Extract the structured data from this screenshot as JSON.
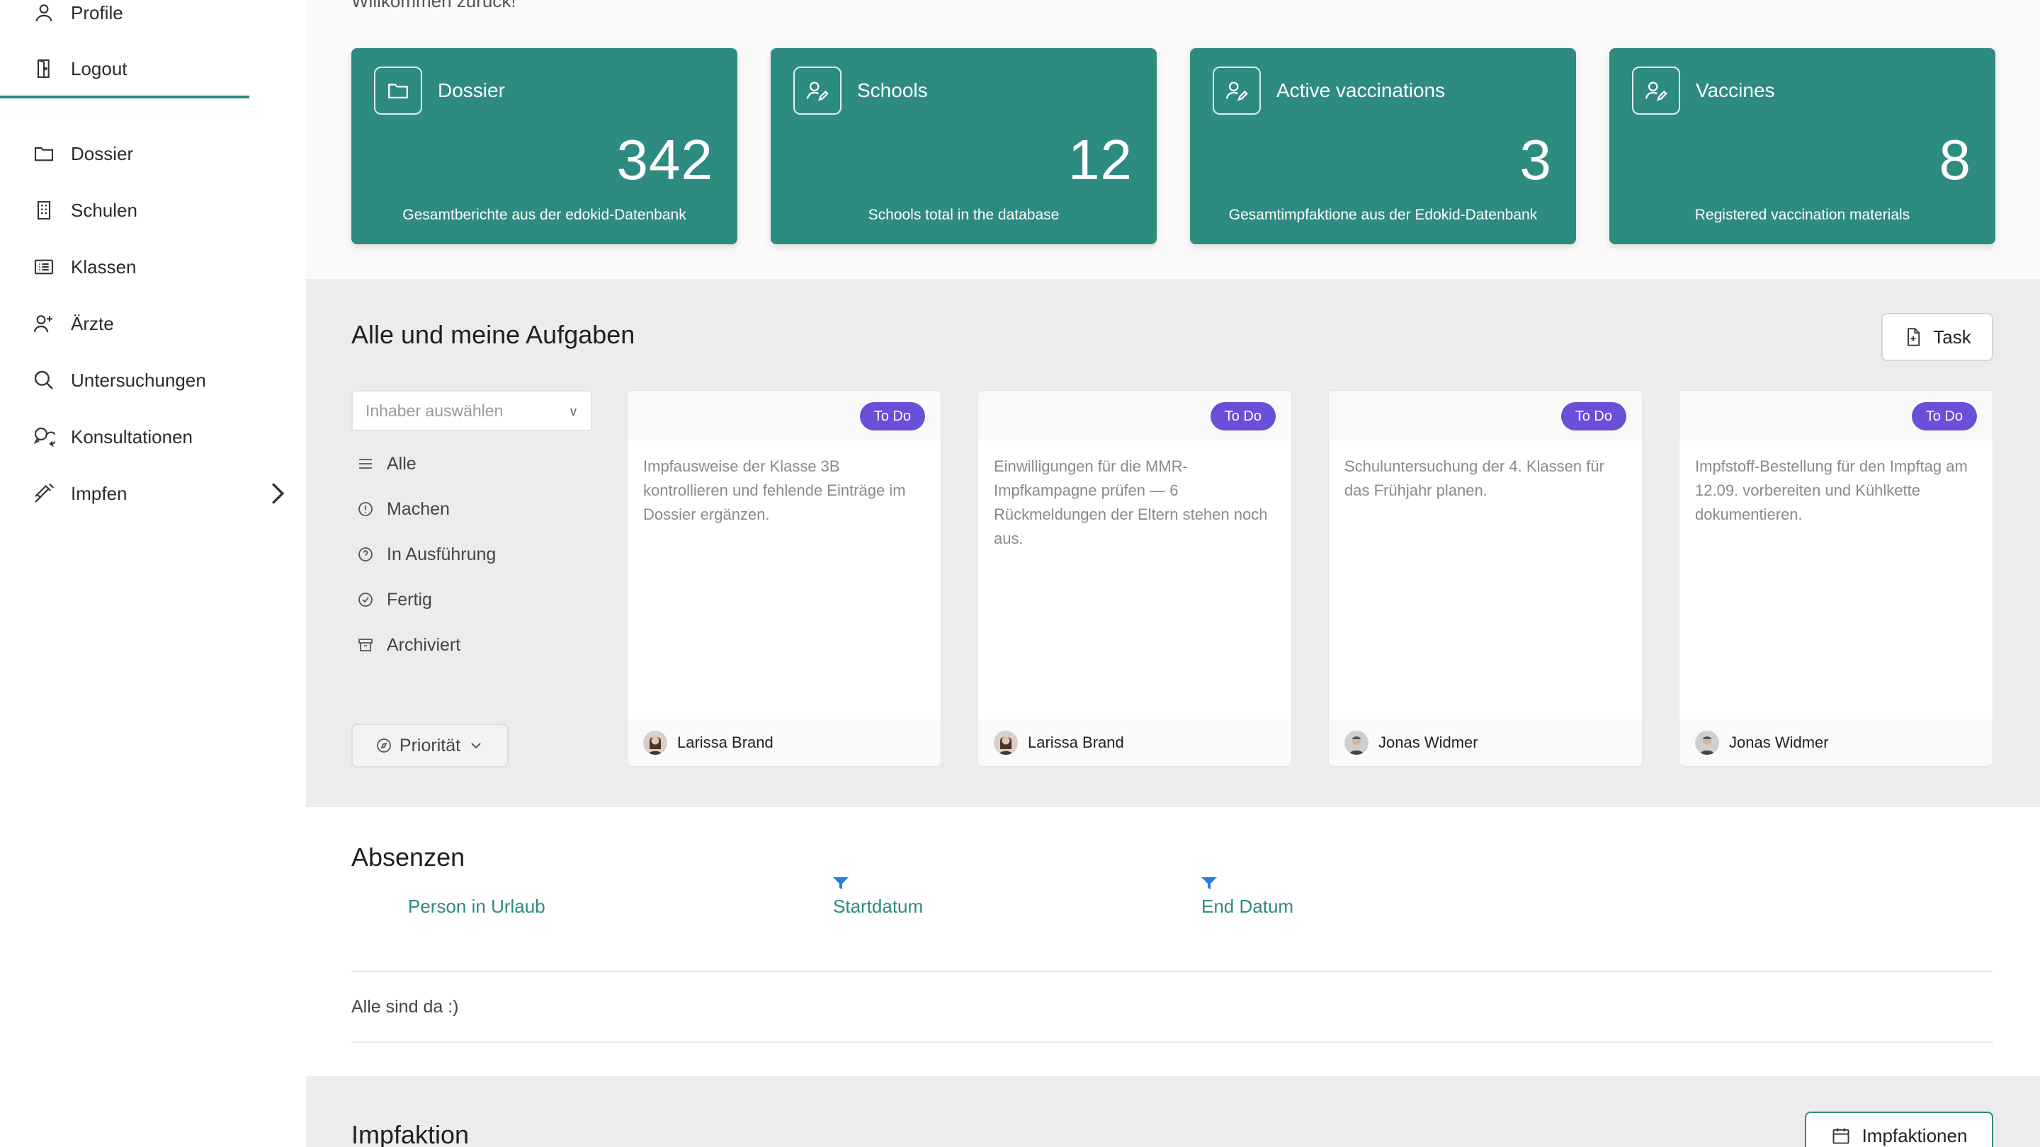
{
  "sidebar": {
    "items": [
      {
        "label": "Profile",
        "icon": "user-icon"
      },
      {
        "label": "Logout",
        "icon": "door-icon"
      },
      {
        "label": "Dossier",
        "icon": "folder-icon"
      },
      {
        "label": "Schulen",
        "icon": "building-icon"
      },
      {
        "label": "Klassen",
        "icon": "list-icon"
      },
      {
        "label": "Ärzte",
        "icon": "user-plus-icon"
      },
      {
        "label": "Untersuchungen",
        "icon": "search-icon"
      },
      {
        "label": "Konsultationen",
        "icon": "chat-icon"
      },
      {
        "label": "Impfen",
        "icon": "syringe-icon"
      }
    ]
  },
  "welcome": "Willkommen zurück!",
  "stats": [
    {
      "title": "Dossier",
      "value": "342",
      "subtitle": "Gesamtberichte aus der edokid-Datenbank",
      "icon": "folder-icon"
    },
    {
      "title": "Schools",
      "value": "12",
      "subtitle": "Schools total in the database",
      "icon": "user-edit-icon"
    },
    {
      "title": "Active vaccinations",
      "value": "3",
      "subtitle": "Gesamtimpfaktione aus der Edokid-Datenbank",
      "icon": "user-edit-icon"
    },
    {
      "title": "Vaccines",
      "value": "8",
      "subtitle": "Registered vaccination materials",
      "icon": "user-edit-icon"
    }
  ],
  "tasks": {
    "title": "Alle und meine Aufgaben",
    "button_label": "Task",
    "owner_placeholder": "Inhaber auswählen",
    "filters": [
      {
        "label": "Alle",
        "icon": "menu-icon"
      },
      {
        "label": "Machen",
        "icon": "alert-circle-icon"
      },
      {
        "label": "In Ausführung",
        "icon": "help-circle-icon"
      },
      {
        "label": "Fertig",
        "icon": "check-circle-icon"
      },
      {
        "label": "Archiviert",
        "icon": "archive-icon"
      }
    ],
    "priority_label": "Priorität",
    "cards": [
      {
        "status": "To Do",
        "text": "Impfausweise der Klasse 3B kontrollieren und fehlende Einträge im Dossier ergänzen.",
        "assignee": "Larissa Brand"
      },
      {
        "status": "To Do",
        "text": "Einwilligungen für die MMR-Impfkampagne prüfen — 6 Rückmeldungen der Eltern stehen noch aus.",
        "assignee": "Larissa Brand"
      },
      {
        "status": "To Do",
        "text": "Schuluntersuchung der 4. Klassen für das Frühjahr planen.",
        "assignee": "Jonas Widmer"
      },
      {
        "status": "To Do",
        "text": "Impfstoff-Bestellung für den Impftag am 12.09. vorbereiten und Kühlkette dokumentieren.",
        "assignee": "Jonas Widmer"
      }
    ]
  },
  "absences": {
    "title": "Absenzen",
    "columns": [
      "Person in Urlaub",
      "Startdatum",
      "End Datum"
    ],
    "empty_text": "Alle sind da :)"
  },
  "vaccination": {
    "title": "Impfaktion",
    "button_label": "Impfaktionen"
  },
  "colors": {
    "accent": "#2e8b80",
    "badge": "#6a4fd8"
  }
}
